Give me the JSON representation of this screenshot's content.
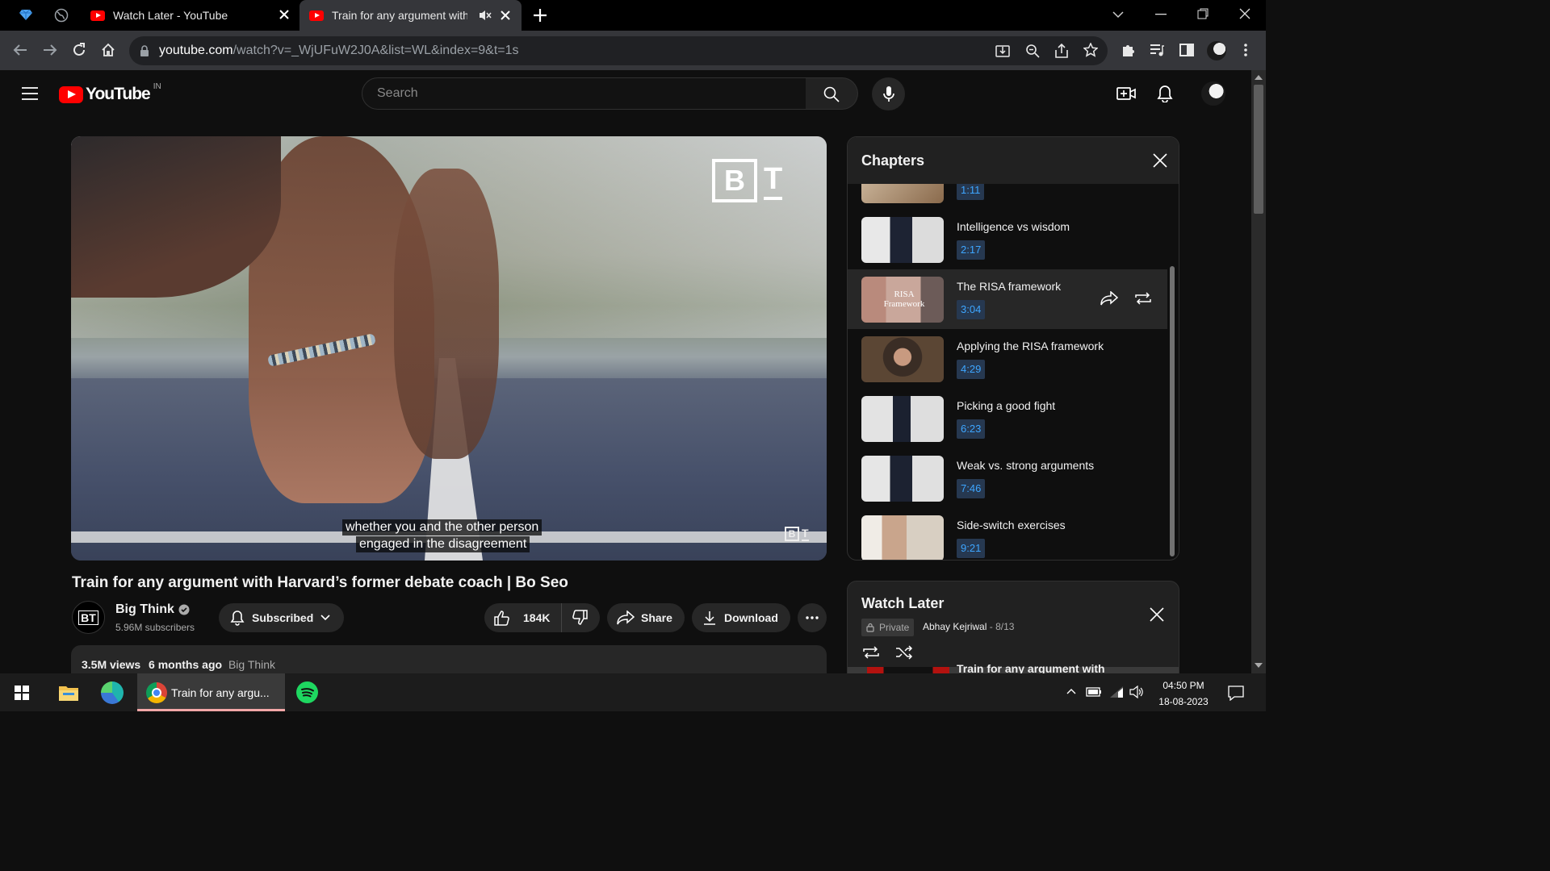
{
  "browser": {
    "tabs": [
      {
        "title": "Watch Later - YouTube",
        "active": false
      },
      {
        "title": "Train for any argument with H",
        "active": true
      }
    ],
    "url_domain": "youtube.com",
    "url_path": "/watch?v=_WjUFuW2J0A&list=WL&index=9&t=1s"
  },
  "youtube": {
    "logo_text": "YouTube",
    "country": "IN",
    "search_placeholder": "Search"
  },
  "player": {
    "captions": [
      "whether you and the other person",
      "engaged in the disagreement"
    ],
    "watermark": "BT"
  },
  "video": {
    "title": "Train for any argument with Harvard’s former debate coach | Bo Seo",
    "channel_name": "Big Think",
    "channel_avatar_text": "BT",
    "subscribers": "5.96M subscribers",
    "subscribed_label": "Subscribed",
    "likes": "184K",
    "share_label": "Share",
    "download_label": "Download",
    "views": "3.5M views",
    "age": "6 months ago",
    "channel_tag": "Big Think"
  },
  "chapters": {
    "heading": "Chapters",
    "items": [
      {
        "title": "",
        "time": "1:11",
        "active": false
      },
      {
        "title": "Intelligence vs wisdom",
        "time": "2:17",
        "active": false
      },
      {
        "title": "The RISA framework",
        "time": "3:04",
        "active": true,
        "thumb_text": "RISA Framework"
      },
      {
        "title": "Applying the RISA framework",
        "time": "4:29",
        "active": false
      },
      {
        "title": "Picking a good fight",
        "time": "6:23",
        "active": false
      },
      {
        "title": "Weak vs. strong arguments",
        "time": "7:46",
        "active": false
      },
      {
        "title": "Side-switch exercises",
        "time": "9:21",
        "active": false
      }
    ]
  },
  "watch_later": {
    "heading": "Watch Later",
    "privacy": "Private",
    "owner": "Abhay Kejriwal",
    "position": "8/13",
    "next_item_partial": "Train for any argument with"
  },
  "taskbar": {
    "chrome_window_title": "Train for any argu...",
    "time": "04:50 PM",
    "date": "18-08-2023"
  },
  "colors": {
    "youtube_red": "#ff0000",
    "chapter_time_blue": "#3ea6ff",
    "background": "#0f0f0f"
  }
}
